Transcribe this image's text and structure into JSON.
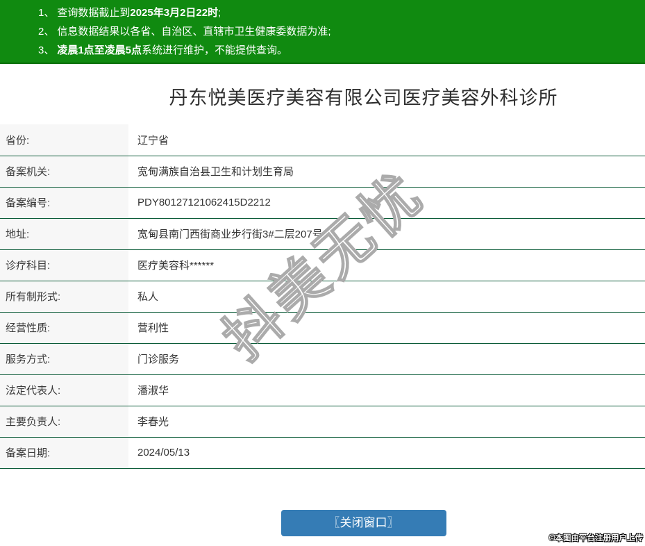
{
  "notice": {
    "items": [
      {
        "num": "1、",
        "pre": "查询数据截止到",
        "bold": "2025年3月2日22时",
        "post": ";"
      },
      {
        "num": "2、",
        "pre": "信息数据结果以各省、自治区、直辖市卫生健康委数据为准;",
        "bold": "",
        "post": ""
      },
      {
        "num": "3、",
        "pre": "",
        "bold": "凌晨1点至凌晨5点",
        "post": "系统进行维护，不能提供查询。"
      }
    ]
  },
  "title": "丹东悦美医疗美容有限公司医疗美容外科诊所",
  "table": {
    "rows": [
      {
        "label": "省份:",
        "value": "辽宁省"
      },
      {
        "label": "备案机关:",
        "value": "宽甸满族自治县卫生和计划生育局"
      },
      {
        "label": "备案编号:",
        "value": "PDY80127121062415D2212"
      },
      {
        "label": "地址:",
        "value": "宽甸县南门西街商业步行街3#二层207号"
      },
      {
        "label": "诊疗科目:",
        "value": "医疗美容科******"
      },
      {
        "label": "所有制形式:",
        "value": "私人"
      },
      {
        "label": "经营性质:",
        "value": "营利性"
      },
      {
        "label": "服务方式:",
        "value": "门诊服务"
      },
      {
        "label": "法定代表人:",
        "value": "潘淑华"
      },
      {
        "label": "主要负责人:",
        "value": "李春光"
      },
      {
        "label": "备案日期:",
        "value": "2024/05/13"
      }
    ]
  },
  "watermark": "抖美无忧",
  "close_button_label": "〖关闭窗口〗",
  "footer_note": "©本图由平台注册用户上传",
  "colors": {
    "banner_green": "#108a10",
    "divider_green": "#0b5b38",
    "button_blue": "#357cb5",
    "label_bg": "#f7f7f7"
  }
}
